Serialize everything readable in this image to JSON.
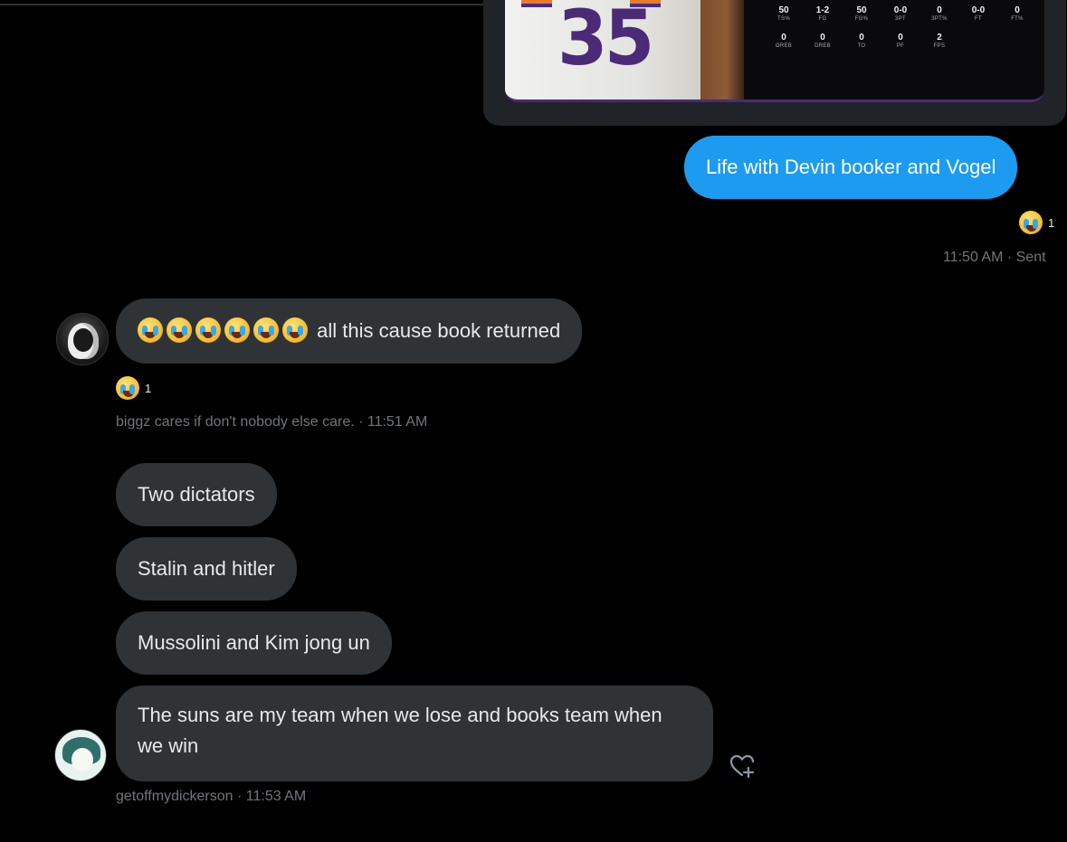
{
  "stat_card": {
    "jersey_number": "35",
    "stats_row1": [
      {
        "value": "50",
        "label": "TS%"
      },
      {
        "value": "1-2",
        "label": "FG"
      },
      {
        "value": "50",
        "label": "FG%"
      },
      {
        "value": "0-0",
        "label": "3PT"
      },
      {
        "value": "0",
        "label": "3PT%"
      },
      {
        "value": "0-0",
        "label": "FT"
      },
      {
        "value": "0",
        "label": "FT%"
      }
    ],
    "stats_row2": [
      {
        "value": "0",
        "label": "OREB"
      },
      {
        "value": "0",
        "label": "DREB"
      },
      {
        "value": "0",
        "label": "TO"
      },
      {
        "value": "0",
        "label": "PF"
      },
      {
        "value": "2",
        "label": "FPS"
      }
    ]
  },
  "messages": {
    "sent_1": {
      "text": "Life with Devin booker and Vogel",
      "reaction_count": "1",
      "meta": "11:50 AM · Sent"
    },
    "recv_1": {
      "text": "all this cause book returned",
      "reaction_count": "1",
      "meta": "biggz cares if don't nobody else care. · 11:51 AM"
    },
    "recv_2": {
      "text": "Two dictators"
    },
    "recv_3": {
      "text": "Stalin and hitler"
    },
    "recv_4": {
      "text": "Mussolini and Kim jong un"
    },
    "recv_5": {
      "text": "The suns are my team when we lose and books team when we win",
      "meta": "getoffmydickerson · 11:53 AM"
    }
  },
  "icons": {
    "reaction_emoji": "face-with-tears-of-joy",
    "add_reaction": "heart-plus-icon"
  },
  "colors": {
    "sent_bubble": "#1d9bf0",
    "received_bubble": "#2f3336",
    "background": "#000000",
    "meta_text": "#71767b"
  }
}
